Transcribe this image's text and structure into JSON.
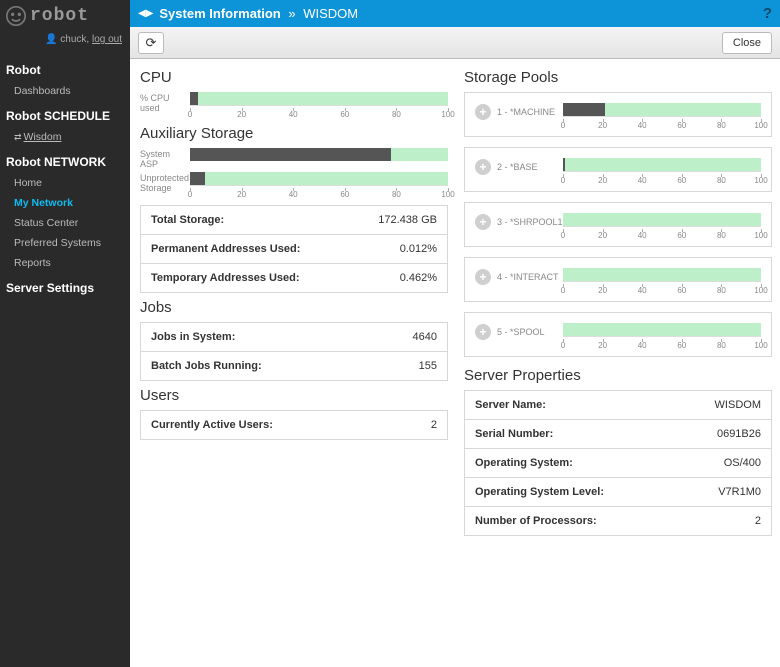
{
  "brand": "robot",
  "user": {
    "name": "chuck",
    "logout": "log out"
  },
  "sidebar": {
    "sections": [
      {
        "title": "Robot",
        "items": [
          {
            "label": "Dashboards",
            "sel": false
          }
        ]
      },
      {
        "title": "Robot SCHEDULE",
        "sub": {
          "label": "Wisdom"
        }
      },
      {
        "title": "Robot NETWORK",
        "items": [
          {
            "label": "Home",
            "sel": false
          },
          {
            "label": "My Network",
            "sel": true
          },
          {
            "label": "Status Center",
            "sel": false
          },
          {
            "label": "Preferred Systems",
            "sel": false
          },
          {
            "label": "Reports",
            "sel": false
          }
        ]
      },
      {
        "title": "Server Settings"
      }
    ]
  },
  "header": {
    "page": "System Information",
    "sep": "»",
    "crumb": "WISDOM"
  },
  "toolbar": {
    "close_label": "Close"
  },
  "cpu": {
    "heading": "CPU",
    "metric_label": "% CPU used",
    "value": 3
  },
  "aux": {
    "heading": "Auxiliary Storage",
    "metrics": [
      {
        "label": "System ASP",
        "value": 78
      },
      {
        "label": "Unprotected Storage",
        "value": 6
      }
    ],
    "rows": [
      {
        "k": "Total Storage:",
        "v": "172.438 GB"
      },
      {
        "k": "Permanent Addresses Used:",
        "v": "0.012%"
      },
      {
        "k": "Temporary Addresses Used:",
        "v": "0.462%"
      }
    ]
  },
  "jobs": {
    "heading": "Jobs",
    "rows": [
      {
        "k": "Jobs in System:",
        "v": "4640"
      },
      {
        "k": "Batch Jobs Running:",
        "v": "155"
      }
    ]
  },
  "users": {
    "heading": "Users",
    "rows": [
      {
        "k": "Currently Active Users:",
        "v": "2"
      }
    ]
  },
  "pools": {
    "heading": "Storage Pools",
    "items": [
      {
        "label": "1 - *MACHINE",
        "value": 21
      },
      {
        "label": "2 - *BASE",
        "value": 1
      },
      {
        "label": "3 - *SHRPOOL1",
        "value": 0
      },
      {
        "label": "4 - *INTERACT",
        "value": 0
      },
      {
        "label": "5 - *SPOOL",
        "value": 0
      }
    ]
  },
  "server_props": {
    "heading": "Server Properties",
    "rows": [
      {
        "k": "Server Name:",
        "v": "WISDOM"
      },
      {
        "k": "Serial Number:",
        "v": "0691B26"
      },
      {
        "k": "Operating System:",
        "v": "OS/400"
      },
      {
        "k": "Operating System Level:",
        "v": "V7R1M0"
      },
      {
        "k": "Number of Processors:",
        "v": "2"
      }
    ]
  },
  "chart_data": {
    "type": "bar",
    "xlabel": "",
    "ylabel": "%",
    "ylim": [
      0,
      100
    ],
    "series": [
      {
        "name": "% CPU used",
        "values": [
          3
        ]
      },
      {
        "name": "System ASP",
        "values": [
          78
        ]
      },
      {
        "name": "Unprotected Storage",
        "values": [
          6
        ]
      },
      {
        "name": "1 - *MACHINE",
        "values": [
          21
        ]
      },
      {
        "name": "2 - *BASE",
        "values": [
          1
        ]
      },
      {
        "name": "3 - *SHRPOOL1",
        "values": [
          0
        ]
      },
      {
        "name": "4 - *INTERACT",
        "values": [
          0
        ]
      },
      {
        "name": "5 - *SPOOL",
        "values": [
          0
        ]
      }
    ],
    "ticks": [
      0,
      20,
      40,
      60,
      80,
      100
    ]
  }
}
